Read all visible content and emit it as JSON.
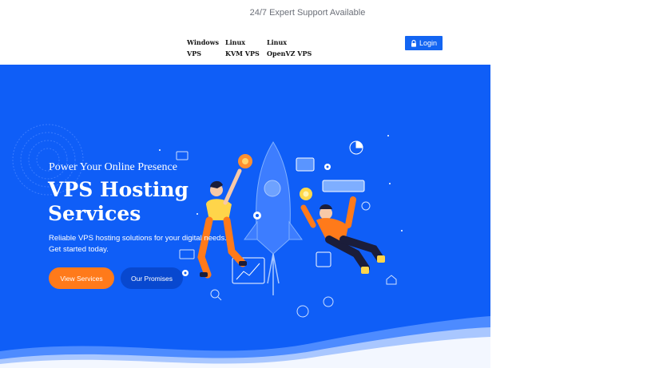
{
  "topbar": {
    "text": "24/7 Expert Support Available"
  },
  "nav": {
    "items": [
      {
        "line1": "Windows",
        "line2": "VPS"
      },
      {
        "line1": "Linux",
        "line2": "KVM VPS"
      },
      {
        "line1": "Linux",
        "line2": "OpenVZ VPS"
      }
    ],
    "login_label": "Login"
  },
  "hero": {
    "kicker": "Power Your Online Presence",
    "title_line1": "VPS Hosting",
    "title_line2": "Services",
    "desc_line1": "Reliable VPS hosting solutions for your digital needs.",
    "desc_line2": "Get started today.",
    "primary_button": "View Services",
    "secondary_button": "Our Promises"
  },
  "colors": {
    "brand_blue": "#0f5ef7",
    "button_blue": "#1365f2",
    "accent_orange": "#ff7a1a",
    "dark_blue": "#0848cf"
  },
  "icons": [
    "lock-icon",
    "rocket-illustration",
    "gear-icon",
    "lightbulb-icon",
    "chart-icon"
  ]
}
